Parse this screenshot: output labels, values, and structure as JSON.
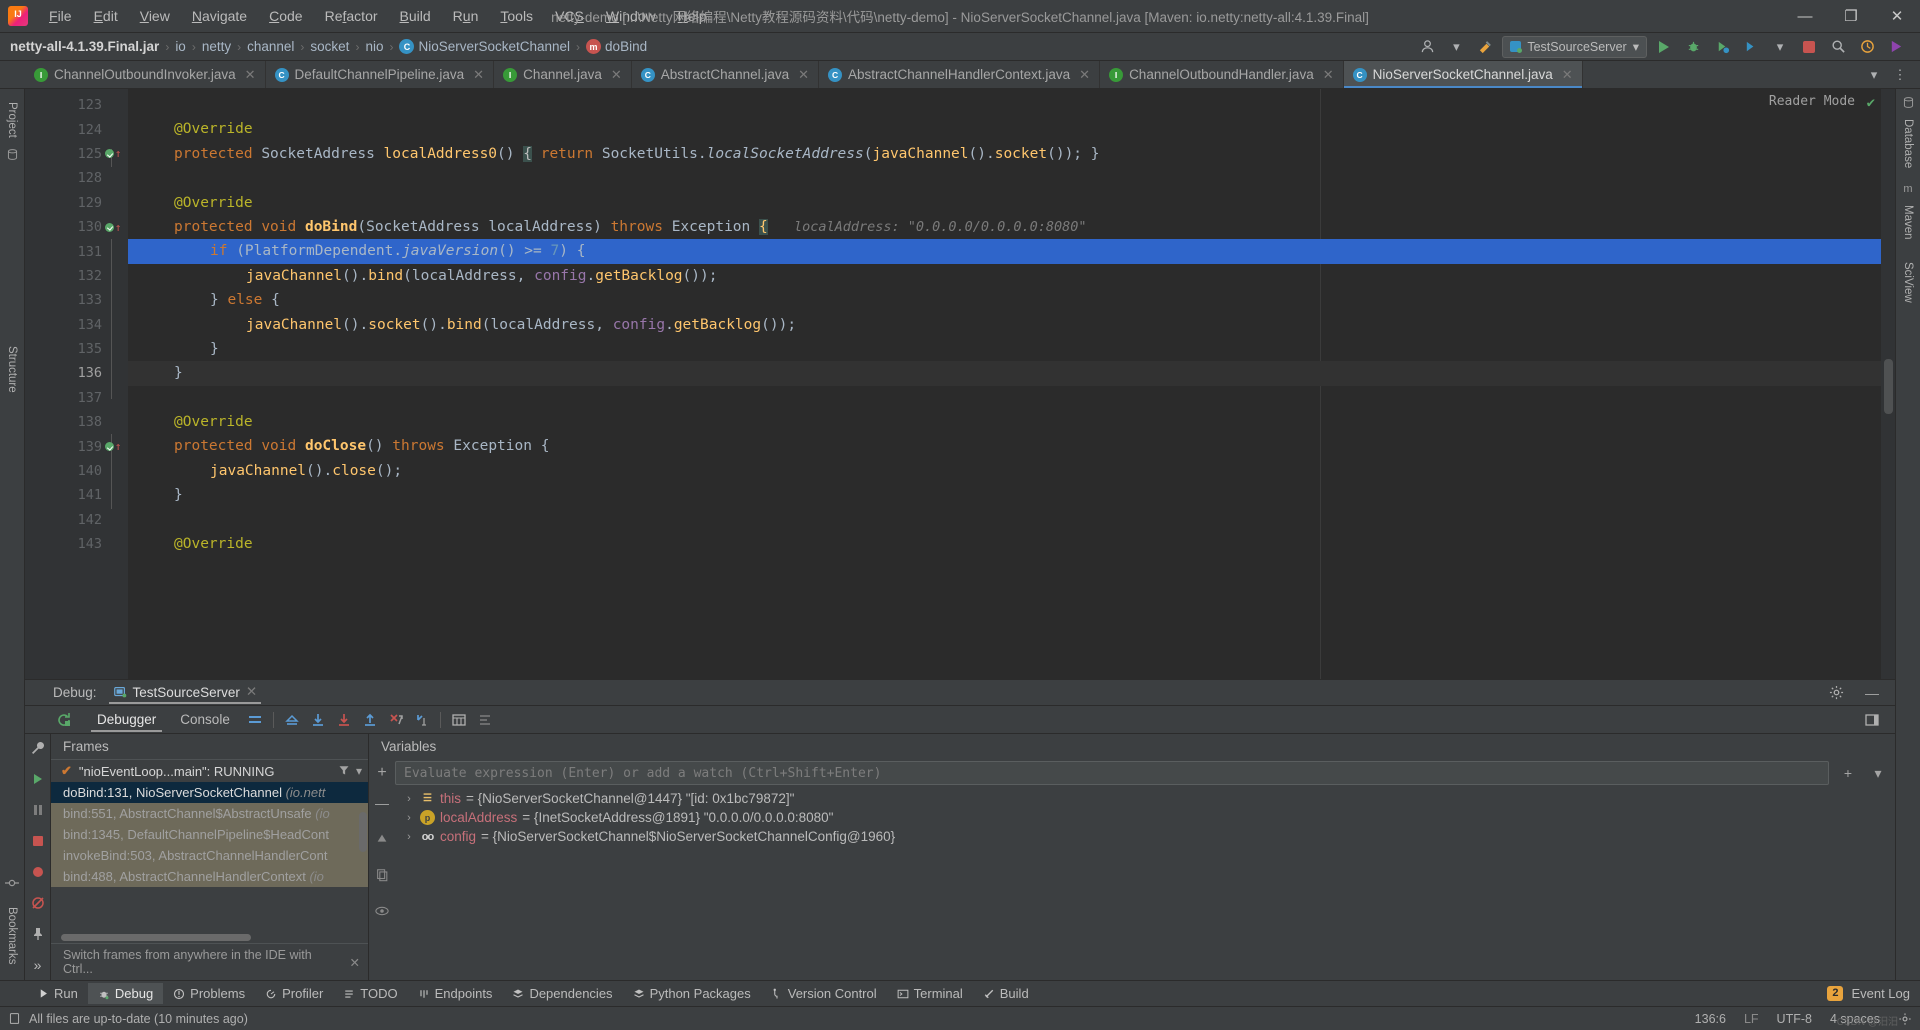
{
  "titlebar": {
    "app_icon": "intellij-idea-logo",
    "menus": [
      "File",
      "Edit",
      "View",
      "Navigate",
      "Code",
      "Refactor",
      "Build",
      "Run",
      "Tools",
      "VCS",
      "Window",
      "Help"
    ],
    "window_title": "netty-demo [...\\Netty网络编程\\Netty教程源码资料\\代码\\netty-demo] - NioServerSocketChannel.java [Maven: io.netty:netty-all:4.1.39.Final]",
    "minimize": "—",
    "maximize": "❐",
    "close": "✕"
  },
  "navbar": {
    "crumbs": [
      {
        "label": "netty-all-4.1.39.Final.jar",
        "icon": "",
        "bold": true
      },
      {
        "label": "io",
        "icon": ""
      },
      {
        "label": "netty",
        "icon": ""
      },
      {
        "label": "channel",
        "icon": ""
      },
      {
        "label": "socket",
        "icon": ""
      },
      {
        "label": "nio",
        "icon": ""
      },
      {
        "label": "NioServerSocketChannel",
        "icon": "class-icon"
      },
      {
        "label": "doBind",
        "icon": "method-icon"
      }
    ],
    "run_config": "TestSourceServer",
    "separator": "›"
  },
  "tabs": [
    {
      "label": "ChannelOutboundInvoker.java",
      "icon": "interface-icon",
      "active": false
    },
    {
      "label": "DefaultChannelPipeline.java",
      "icon": "class-icon",
      "active": false
    },
    {
      "label": "Channel.java",
      "icon": "interface-icon",
      "active": false
    },
    {
      "label": "AbstractChannel.java",
      "icon": "class-icon",
      "active": false
    },
    {
      "label": "AbstractChannelHandlerContext.java",
      "icon": "class-icon",
      "active": false
    },
    {
      "label": "ChannelOutboundHandler.java",
      "icon": "interface-icon",
      "active": false
    },
    {
      "label": "NioServerSocketChannel.java",
      "icon": "class-icon",
      "active": true
    }
  ],
  "editor": {
    "reader_mode_label": "Reader Mode",
    "lines": [
      {
        "num": "123",
        "text": ""
      },
      {
        "num": "124",
        "text": "    @Override"
      },
      {
        "num": "125",
        "text": "    protected SocketAddress localAddress0() { return SocketUtils.localSocketAddress(javaChannel().socket()); }"
      },
      {
        "num": "128",
        "text": ""
      },
      {
        "num": "129",
        "text": "    @Override"
      },
      {
        "num": "130",
        "text": "    protected void doBind(SocketAddress localAddress) throws Exception {",
        "hint": "localAddress: \"0.0.0.0/0.0.0.0:8080\""
      },
      {
        "num": "131",
        "text": "        if (PlatformDependent.javaVersion() >= 7) {",
        "highlight": true
      },
      {
        "num": "132",
        "text": "            javaChannel().bind(localAddress, config.getBacklog());"
      },
      {
        "num": "133",
        "text": "        } else {"
      },
      {
        "num": "134",
        "text": "            javaChannel().socket().bind(localAddress, config.getBacklog());"
      },
      {
        "num": "135",
        "text": "        }"
      },
      {
        "num": "136",
        "text": "    }",
        "caret": true
      },
      {
        "num": "137",
        "text": ""
      },
      {
        "num": "138",
        "text": "    @Override"
      },
      {
        "num": "139",
        "text": "    protected void doClose() throws Exception {"
      },
      {
        "num": "140",
        "text": "        javaChannel().close();"
      },
      {
        "num": "141",
        "text": "    }"
      },
      {
        "num": "142",
        "text": ""
      },
      {
        "num": "143",
        "text": "    @Override"
      }
    ]
  },
  "debug": {
    "header_label": "Debug:",
    "session_name": "TestSourceServer",
    "tabs": [
      "Debugger",
      "Console"
    ],
    "active_tab": "Debugger",
    "frames_title": "Frames",
    "variables_title": "Variables",
    "thread_label": "\"nioEventLoop...main\": RUNNING",
    "frames": [
      {
        "label": "doBind:131, NioServerSocketChannel",
        "pkg": "(io.nett",
        "selected": true
      },
      {
        "label": "bind:551, AbstractChannel$AbstractUnsafe",
        "pkg": "(io",
        "selected": false
      },
      {
        "label": "bind:1345, DefaultChannelPipeline$HeadCont",
        "pkg": "",
        "selected": false
      },
      {
        "label": "invokeBind:503, AbstractChannelHandlerCont",
        "pkg": "",
        "selected": false
      },
      {
        "label": "bind:488, AbstractChannelHandlerContext",
        "pkg": "(io",
        "selected": false
      }
    ],
    "frames_tip": "Switch frames from anywhere in the IDE with Ctrl...",
    "eval_placeholder": "Evaluate expression (Enter) or add a watch (Ctrl+Shift+Enter)",
    "variables": [
      {
        "icon": "this-icon",
        "name": "this",
        "value": "= {NioServerSocketChannel@1447} \"[id: 0x1bc79872]\""
      },
      {
        "icon": "parameter-icon",
        "name": "localAddress",
        "value": "= {InetSocketAddress@1891} \"0.0.0.0/0.0.0.0:8080\""
      },
      {
        "icon": "field-icon",
        "name": "config",
        "value": "= {NioServerSocketChannel$NioServerSocketChannelConfig@1960}"
      }
    ]
  },
  "toolstrip": {
    "buttons": [
      {
        "label": "Run",
        "icon": "play-icon",
        "selected": false
      },
      {
        "label": "Debug",
        "icon": "bug-icon",
        "selected": true
      },
      {
        "label": "Problems",
        "icon": "problems-icon",
        "selected": false
      },
      {
        "label": "Profiler",
        "icon": "profiler-icon",
        "selected": false
      },
      {
        "label": "TODO",
        "icon": "todo-icon",
        "selected": false
      },
      {
        "label": "Endpoints",
        "icon": "endpoints-icon",
        "selected": false
      },
      {
        "label": "Dependencies",
        "icon": "dependencies-icon",
        "selected": false
      },
      {
        "label": "Python Packages",
        "icon": "python-icon",
        "selected": false
      },
      {
        "label": "Version Control",
        "icon": "vcs-icon",
        "selected": false
      },
      {
        "label": "Terminal",
        "icon": "terminal-icon",
        "selected": false
      },
      {
        "label": "Build",
        "icon": "build-icon",
        "selected": false
      }
    ],
    "event_log": "Event Log",
    "event_log_count": "2"
  },
  "statusbar": {
    "message": "All files are up-to-date (10 minutes ago)",
    "caret": "136:6",
    "line_sep": "LF",
    "encoding": "UTF-8",
    "indent": "4 spaces",
    "watermark": "CSDN @汨汨"
  },
  "rails": {
    "left_top": [
      "Project"
    ],
    "left_mid": [
      "Structure"
    ],
    "left_bottom": [
      "Bookmarks"
    ],
    "right": [
      "Database",
      "Maven",
      "SciView"
    ]
  },
  "colors": {
    "background": "#3c3f41",
    "editor_bg": "#2b2b2b",
    "accent_blue": "#3592c4",
    "highlight_line": "#2f65ca",
    "green": "#59a869",
    "orange": "#cc7832",
    "string_green": "#6a8759",
    "keyword_orange": "#cc7832",
    "method_yellow": "#ffc66d",
    "field_purple": "#9876aa",
    "number_blue": "#6897bb",
    "annotation": "#bbb529",
    "frame_selected": "#0d293e"
  }
}
